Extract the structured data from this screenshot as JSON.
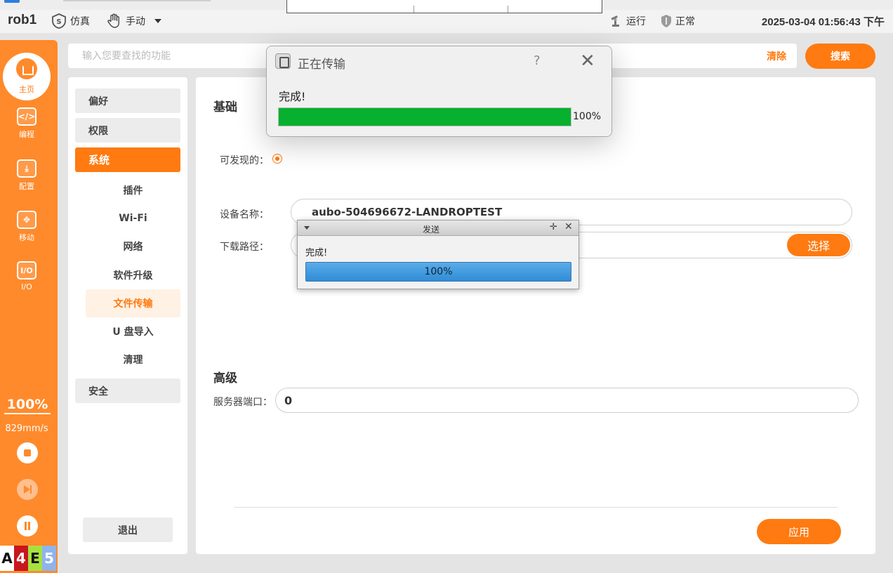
{
  "topbar": {
    "robot_name": "rob1",
    "sim_label": "仿真",
    "mode_label": "手动",
    "run_label": "运行",
    "state_label": "正常",
    "datetime": "2025-03-04 01:56:43 下午"
  },
  "sidebar": {
    "home_label": "主页",
    "items": [
      {
        "label": "编程",
        "icon_text": "</>"
      },
      {
        "label": "配置",
        "icon_text": "⤓"
      },
      {
        "label": "移动",
        "icon_text": "✥"
      },
      {
        "label": "I/O",
        "icon_text": "I/O"
      }
    ],
    "speed_percent": "100%",
    "speed_mm": "829mm/s",
    "status_letters": [
      "A",
      "4",
      "E",
      "5"
    ]
  },
  "search": {
    "placeholder": "输入您要查找的功能",
    "clear_label": "清除",
    "search_label": "搜索"
  },
  "settings_nav": {
    "preferences": "偏好",
    "permissions": "权限",
    "system": "系统",
    "sub_items": [
      "插件",
      "Wi-Fi",
      "网络",
      "软件升级",
      "文件传输",
      "U 盘导入",
      "清理"
    ],
    "safety": "安全",
    "logout": "退出"
  },
  "content": {
    "basic_title": "基础",
    "discoverable_label": "可发现的：",
    "device_name_label": "设备名称：",
    "device_name_value": "aubo-504696672-LANDROPTEST",
    "download_path_label": "下载路径：",
    "select_label": "选择",
    "advanced_title": "高级",
    "server_port_label": "服务器端口：",
    "server_port_value": "0",
    "apply_label": "应用"
  },
  "transfer_dialog": {
    "title": "正在传输",
    "help": "?",
    "message": "完成!",
    "progress": 100,
    "progress_text": "100%"
  },
  "send_dialog": {
    "title": "发送",
    "message": "完成!",
    "progress": 100,
    "progress_text": "100%"
  },
  "colors": {
    "accent": "#ff7a10",
    "sidebar": "#ff8a2b",
    "progress_green": "#07b02e",
    "progress_blue": "#2f8cd6"
  }
}
